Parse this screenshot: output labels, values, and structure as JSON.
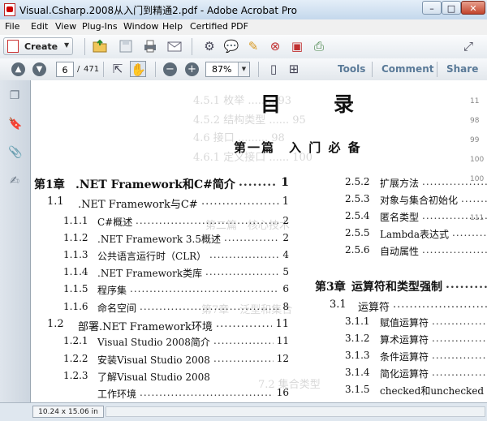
{
  "window": {
    "title": "Visual.Csharp.2008从入门到精通2.pdf - Adobe Acrobat Pro",
    "controls": {
      "minimize": "–",
      "maximize": "□",
      "close": "✕"
    }
  },
  "menu": [
    "File",
    "Edit",
    "View",
    "Plug-Ins",
    "Window",
    "Help",
    "Certified PDF"
  ],
  "toolbar": {
    "create_label": "Create",
    "icons": [
      "open-folder-icon",
      "save-icon",
      "print-icon",
      "email-icon",
      "gear-icon",
      "comment-icon",
      "sign-icon",
      "secure-icon",
      "certify-icon",
      "review-icon",
      "expand-icon"
    ]
  },
  "nav": {
    "page_current": "6",
    "page_sep": "/",
    "page_total": "471",
    "zoom": "87%",
    "tools_label": "Tools",
    "comment_label": "Comment",
    "share_label": "Share"
  },
  "document": {
    "heading_left": "目",
    "heading_right": "录",
    "part_title": "第一篇　入 门 必 备",
    "left_entries": [
      {
        "num": "第1章",
        "title": ".NET Framework和C#简介",
        "page": "1",
        "level": 0
      },
      {
        "num": "1.1",
        "title": ".NET Framework与C#",
        "page": "1",
        "level": 1
      },
      {
        "num": "1.1.1",
        "title": "C#概述",
        "page": "2",
        "level": 2
      },
      {
        "num": "1.1.2",
        "title": ".NET Framework 3.5概述",
        "page": "2",
        "level": 2
      },
      {
        "num": "1.1.3",
        "title": "公共语言运行时（CLR）",
        "page": "4",
        "level": 2
      },
      {
        "num": "1.1.4",
        "title": ".NET Framework类库",
        "page": "5",
        "level": 2
      },
      {
        "num": "1.1.5",
        "title": "程序集",
        "page": "6",
        "level": 2
      },
      {
        "num": "1.1.6",
        "title": "命名空间",
        "page": "8",
        "level": 2
      },
      {
        "num": "1.2",
        "title": "部署.NET Framework环境",
        "page": "11",
        "level": 1
      },
      {
        "num": "1.2.1",
        "title": "Visual Studio 2008简介",
        "page": "11",
        "level": 2
      },
      {
        "num": "1.2.2",
        "title": "安装Visual Studio 2008",
        "page": "12",
        "level": 2
      },
      {
        "num": "1.2.3",
        "title": "了解Visual Studio 2008",
        "page": "",
        "level": 2
      },
      {
        "num": "",
        "title": "工作环境",
        "page": "16",
        "level": 2
      }
    ],
    "right_entries": [
      {
        "num": "2.5.2",
        "title": "扩展方法",
        "level": 2
      },
      {
        "num": "2.5.3",
        "title": "对象与集合初始化",
        "level": 2
      },
      {
        "num": "2.5.4",
        "title": "匿名类型",
        "level": 2
      },
      {
        "num": "2.5.5",
        "title": "Lambda表达式",
        "level": 2
      },
      {
        "num": "2.5.6",
        "title": "自动属性",
        "level": 2
      },
      {
        "num": "第3章",
        "title": "运算符和类型强制",
        "level": 0
      },
      {
        "num": "3.1",
        "title": "运算符",
        "level": 1
      },
      {
        "num": "3.1.1",
        "title": "赋值运算符",
        "level": 2
      },
      {
        "num": "3.1.2",
        "title": "算术运算符",
        "level": 2
      },
      {
        "num": "3.1.3",
        "title": "条件运算符",
        "level": 2
      },
      {
        "num": "3.1.4",
        "title": "简化运算符",
        "level": 2
      },
      {
        "num": "3.1.5",
        "title": "checked和unchecked",
        "level": 2
      }
    ]
  },
  "status": {
    "page_size": "10.24 x 15.06 in"
  }
}
